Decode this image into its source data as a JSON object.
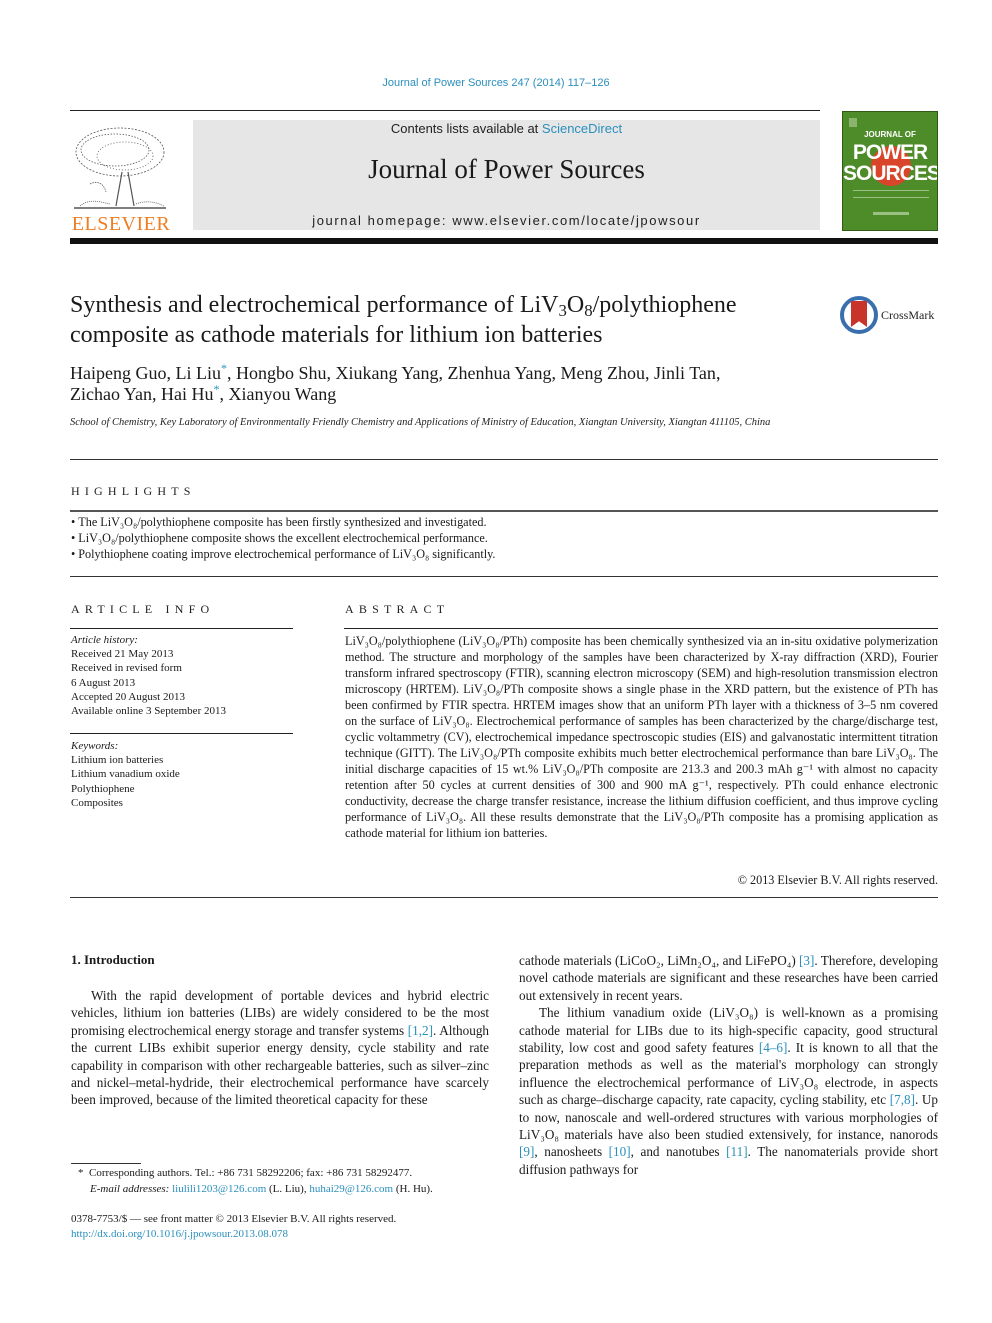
{
  "header": {
    "citation": "Journal of Power Sources 247 (2014) 117–126",
    "contents_prefix": "Contents lists available at ",
    "contents_link": "ScienceDirect",
    "journal_name": "Journal of Power Sources",
    "homepage": "journal homepage: www.elsevier.com/locate/jpowsour",
    "publisher_logo_text": "ELSEVIER",
    "cover": {
      "line1": "JOURNAL OF",
      "line2": "POWER",
      "line3": "SOURCES",
      "color": "#4e8c2a"
    },
    "crossmark_label": "CrossMark",
    "colors": {
      "link": "#2a8fbd",
      "elsevier_orange": "#ef7d22",
      "masthead_bg": "#e6e6e6"
    }
  },
  "article": {
    "title_part1": "Synthesis and electrochemical performance of LiV",
    "title_sub1": "3",
    "title_part2": "O",
    "title_sub2": "8",
    "title_part3": "/polythiophene composite as cathode materials for lithium ion batteries",
    "authors": [
      {
        "name": "Haipeng Guo",
        "corresponding": false
      },
      {
        "name": "Li Liu",
        "corresponding": true
      },
      {
        "name": "Hongbo Shu",
        "corresponding": false
      },
      {
        "name": "Xiukang Yang",
        "corresponding": false
      },
      {
        "name": "Zhenhua Yang",
        "corresponding": false
      },
      {
        "name": "Meng Zhou",
        "corresponding": false
      },
      {
        "name": "Jinli Tan",
        "corresponding": false
      },
      {
        "name": "Zichao Yan",
        "corresponding": false
      },
      {
        "name": "Hai Hu",
        "corresponding": true
      },
      {
        "name": "Xianyou Wang",
        "corresponding": false
      }
    ],
    "affiliation": "School of Chemistry, Key Laboratory of Environmentally Friendly Chemistry and Applications of Ministry of Education, Xiangtan University, Xiangtan 411105, China"
  },
  "highlights": {
    "heading": "HIGHLIGHTS",
    "items": [
      "The LiV₃O₈/polythiophene composite has been firstly synthesized and investigated.",
      "LiV₃O₈/polythiophene composite shows the excellent electrochemical performance.",
      "Polythiophene coating improve electrochemical performance of LiV₃O₈ significantly."
    ]
  },
  "article_info": {
    "heading": "ARTICLE INFO",
    "history_label": "Article history:",
    "history": [
      "Received 21 May 2013",
      "Received in revised form",
      "6 August 2013",
      "Accepted 20 August 2013",
      "Available online 3 September 2013"
    ],
    "keywords_label": "Keywords:",
    "keywords": [
      "Lithium ion batteries",
      "Lithium vanadium oxide",
      "Polythiophene",
      "Composites"
    ]
  },
  "abstract": {
    "heading": "ABSTRACT",
    "text": "LiV₃O₈/polythiophene (LiV₃O₈/PTh) composite has been chemically synthesized via an in-situ oxidative polymerization method. The structure and morphology of the samples have been characterized by X-ray diffraction (XRD), Fourier transform infrared spectroscopy (FTIR), scanning electron microscopy (SEM) and high-resolution transmission electron microscopy (HRTEM). LiV₃O₈/PTh composite shows a single phase in the XRD pattern, but the existence of PTh has been confirmed by FTIR spectra. HRTEM images show that an uniform PTh layer with a thickness of 3–5 nm covered on the surface of LiV₃O₈. Electrochemical performance of samples has been characterized by the charge/discharge test, cyclic voltammetry (CV), electrochemical impedance spectroscopic studies (EIS) and galvanostatic intermittent titration technique (GITT). The LiV₃O₈/PTh composite exhibits much better electrochemical performance than bare LiV₃O₈. The initial discharge capacities of 15 wt.% LiV₃O₈/PTh composite are 213.3 and 200.3 mAh g⁻¹ with almost no capacity retention after 50 cycles at current densities of 300 and 900 mA g⁻¹, respectively. PTh could enhance electronic conductivity, decrease the charge transfer resistance, increase the lithium diffusion coefficient, and thus improve cycling performance of LiV₃O₈. All these results demonstrate that the LiV₃O₈/PTh composite has a promising application as cathode material for lithium ion batteries.",
    "copyright": "© 2013 Elsevier B.V. All rights reserved."
  },
  "body": {
    "section_heading": "1.  Introduction",
    "left_paragraph": {
      "t1": "With the rapid development of portable devices and hybrid electric vehicles, lithium ion batteries (LIBs) are widely considered to be the most promising electrochemical energy storage and transfer systems ",
      "ref1": "[1,2]",
      "t2": ". Although the current LIBs exhibit superior energy density, cycle stability and rate capability in comparison with other rechargeable batteries, such as silver–zinc and nickel–metal-hydride, their electrochemical performance have scarcely been improved, because of the limited theoretical capacity for these"
    },
    "right_paragraph1": {
      "t1": "cathode materials (LiCoO₂, LiMn₂O₄, and LiFePO₄) ",
      "ref1": "[3]",
      "t2": ". Therefore, developing novel cathode materials are significant and these researches have been carried out extensively in recent years."
    },
    "right_paragraph2": {
      "t1": "The lithium vanadium oxide (LiV₃O₈) is well-known as a promising cathode material for LIBs due to its high-specific capacity, good structural stability, low cost and good safety features ",
      "ref1": "[4–6]",
      "t2": ". It is known to all that the preparation methods as well as the material's morphology can strongly influence the electrochemical performance of LiV₃O₈ electrode, in aspects such as charge–discharge capacity, rate capacity, cycling stability, etc ",
      "ref2": "[7,8]",
      "t3": ". Up to now, nanoscale and well-ordered structures with various morphologies of LiV₃O₈ materials have also been studied extensively, for instance, nanorods ",
      "ref3": "[9]",
      "t4": ", nanosheets ",
      "ref4": "[10]",
      "t5": ", and nanotubes ",
      "ref5": "[11]",
      "t6": ". The nanomaterials provide short diffusion pathways for"
    }
  },
  "footnote": {
    "marker": "*",
    "corresponding": "Corresponding authors. Tel.: +86 731 58292206; fax: +86 731 58292477.",
    "email_label": "E-mail addresses:",
    "email1": "liulili1203@126.com",
    "email1_owner": " (L. Liu), ",
    "email2": "huhai29@126.com",
    "email2_owner": " (H. Hu)."
  },
  "issn": {
    "line": "0378-7753/$ — see front matter © 2013 Elsevier B.V. All rights reserved.",
    "doi": "http://dx.doi.org/10.1016/j.jpowsour.2013.08.078"
  }
}
